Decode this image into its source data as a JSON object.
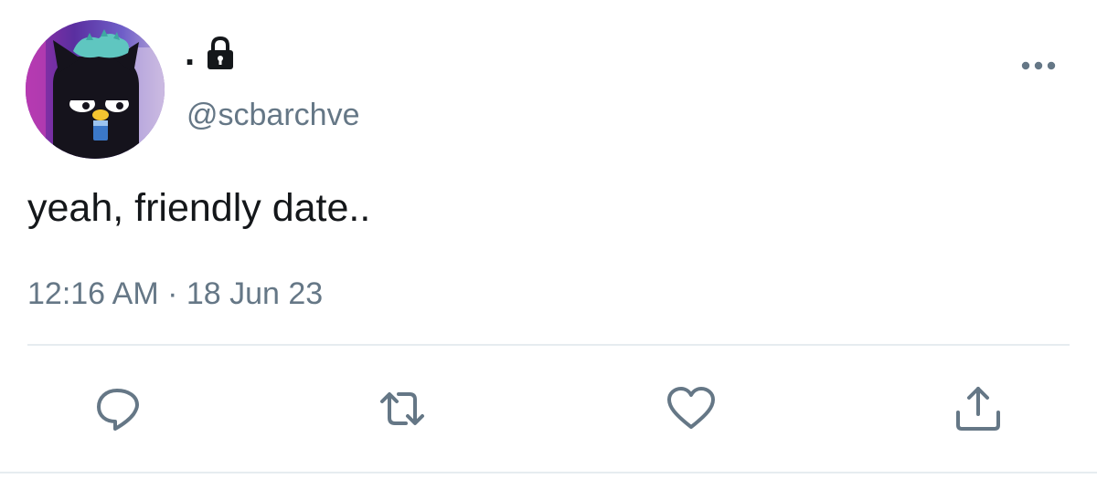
{
  "tweet": {
    "display_name": ".",
    "handle": "@scbarchve",
    "text": "yeah, friendly date..",
    "timestamp": "12:16 AM · 18 Jun 23",
    "protected_icon": "lock-icon",
    "more_icon": "more-horizontal-icon"
  },
  "actions": [
    {
      "name": "reply",
      "icon": "reply-icon"
    },
    {
      "name": "retweet",
      "icon": "retweet-icon"
    },
    {
      "name": "like",
      "icon": "heart-icon"
    },
    {
      "name": "share",
      "icon": "share-icon"
    }
  ],
  "colors": {
    "text": "#14171a",
    "secondary": "#657786",
    "icon": "#657786",
    "divider": "#e6ecf0"
  }
}
